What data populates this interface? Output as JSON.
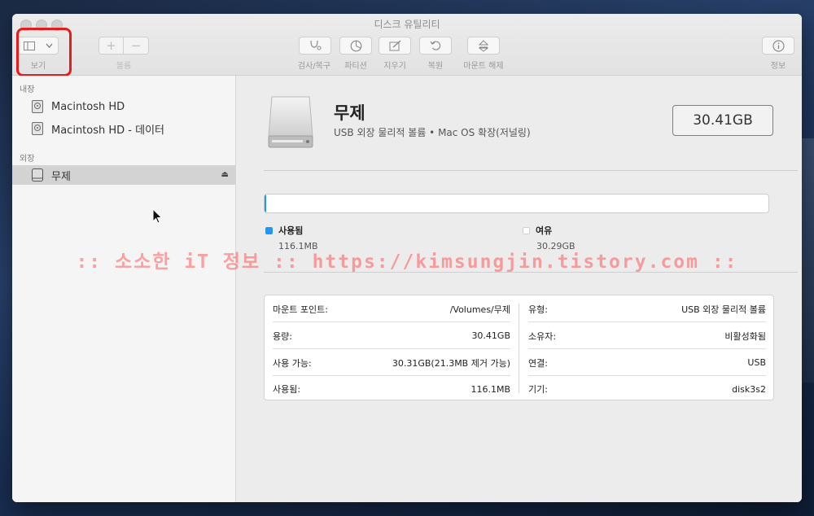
{
  "window": {
    "title": "디스크 유틸리티"
  },
  "toolbar": {
    "view_label": "보기",
    "volume_label": "볼륨",
    "first_aid_label": "검사/복구",
    "partition_label": "파티션",
    "erase_label": "지우기",
    "restore_label": "복원",
    "unmount_label": "마운트 해제",
    "info_label": "정보"
  },
  "sidebar": {
    "internal_heading": "내장",
    "external_heading": "외장",
    "internal_items": [
      {
        "label": "Macintosh HD",
        "icon": "internal-disk-icon"
      },
      {
        "label": "Macintosh HD - 데이터",
        "icon": "internal-disk-icon"
      }
    ],
    "external_items": [
      {
        "label": "무제",
        "icon": "external-disk-icon",
        "selected": true
      }
    ]
  },
  "volume": {
    "name": "무제",
    "description": "USB 외장 물리적 볼륨 • Mac OS 확장(저널링)",
    "capacity": "30.41GB"
  },
  "usage": {
    "used_fraction": 0.004,
    "used_label": "사용됨",
    "used_value": "116.1MB",
    "free_label": "여유",
    "free_value": "30.29GB",
    "used_color": "#2196f3",
    "free_color": "#ffffff"
  },
  "details": {
    "left": [
      {
        "key": "마운트 포인트:",
        "value": "/Volumes/무제"
      },
      {
        "key": "용량:",
        "value": "30.41GB"
      },
      {
        "key": "사용 가능:",
        "value": "30.31GB(21.3MB 제거 가능)"
      },
      {
        "key": "사용됨:",
        "value": "116.1MB"
      }
    ],
    "right": [
      {
        "key": "유형:",
        "value": "USB 외장 물리적 볼륨"
      },
      {
        "key": "소유자:",
        "value": "비활성화됨"
      },
      {
        "key": "연결:",
        "value": "USB"
      },
      {
        "key": "기기:",
        "value": "disk3s2"
      }
    ]
  },
  "watermark": ":: 소소한 iT 정보 :: https://kimsungjin.tistory.com ::"
}
